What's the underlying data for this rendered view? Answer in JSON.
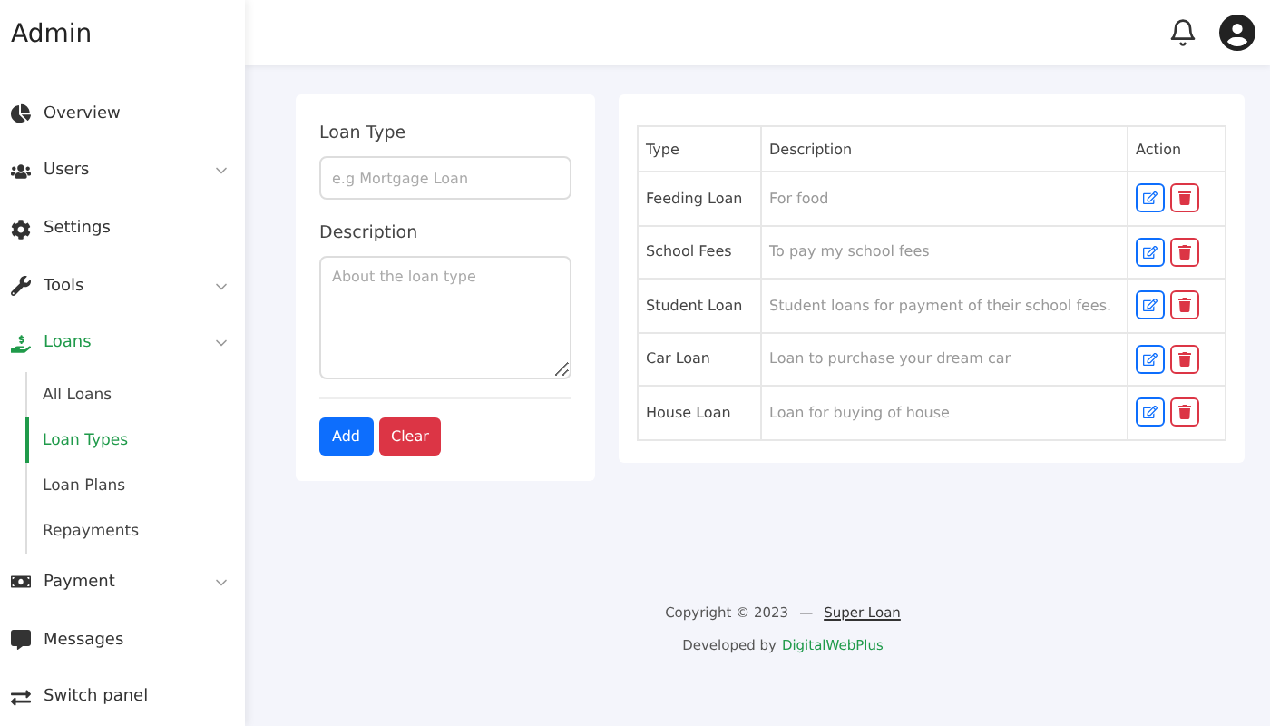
{
  "sidebar": {
    "title": "Admin",
    "items": [
      {
        "label": "Overview",
        "kind": "overview",
        "selected": false,
        "expandable": false
      },
      {
        "label": "Users",
        "kind": "users",
        "selected": false,
        "expandable": true
      },
      {
        "label": "Settings",
        "kind": "settings",
        "selected": false,
        "expandable": false
      },
      {
        "label": "Tools",
        "kind": "tools",
        "selected": false,
        "expandable": true
      },
      {
        "label": "Loans",
        "kind": "loans",
        "selected": true,
        "expandable": true,
        "children": [
          {
            "label": "All Loans",
            "selected": false
          },
          {
            "label": "Loan Types",
            "selected": true
          },
          {
            "label": "Loan Plans",
            "selected": false
          },
          {
            "label": "Repayments",
            "selected": false
          }
        ]
      },
      {
        "label": "Payment",
        "kind": "payment",
        "selected": false,
        "expandable": true
      },
      {
        "label": "Messages",
        "kind": "messages",
        "selected": false,
        "expandable": false
      },
      {
        "label": "Switch panel",
        "kind": "switch",
        "selected": false,
        "expandable": false
      }
    ]
  },
  "form": {
    "fields": [
      {
        "label": "Loan Type",
        "kind": "input",
        "placeholder": "e.g Mortgage Loan"
      },
      {
        "label": "Description",
        "kind": "textarea",
        "placeholder": "About the loan type"
      }
    ],
    "buttons": [
      {
        "label": "Add",
        "kind": "primary"
      },
      {
        "label": "Clear",
        "kind": "danger"
      }
    ]
  },
  "table": {
    "columns": [
      "Type",
      "Description",
      "Action"
    ],
    "rows": [
      {
        "type": "Feeding Loan",
        "description": "For food"
      },
      {
        "type": "School Fees",
        "description": "To pay my school fees"
      },
      {
        "type": "Student Loan",
        "description": "Student loans for payment of their school fees."
      },
      {
        "type": "Car Loan",
        "description": "Loan to purchase your dream car"
      },
      {
        "type": "House Loan",
        "description": "Loan for buying of house"
      }
    ]
  },
  "footer": {
    "copyright": "Copyright © 2023",
    "separator": "—",
    "brand": "Super Loan",
    "developed_by": "Developed by",
    "developer": "DigitalWebPlus"
  }
}
